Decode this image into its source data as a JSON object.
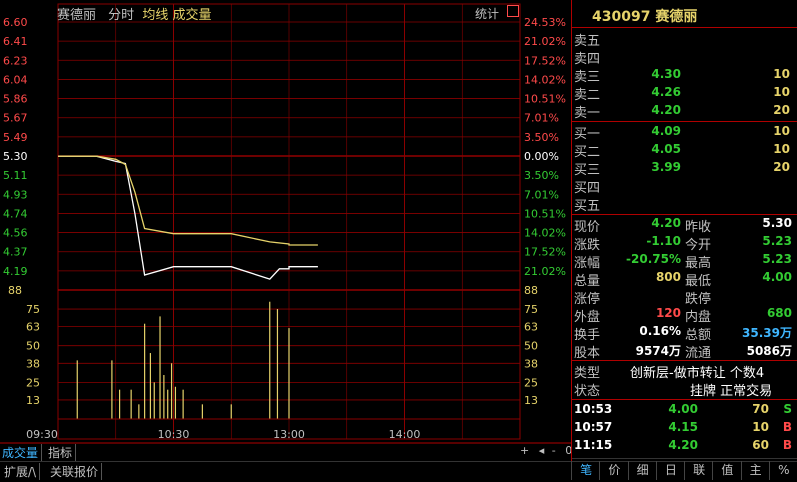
{
  "chart_header": {
    "stock_name": "赛德丽",
    "mode_tab": "分时",
    "legend_avg": "均线",
    "legend_vol": "成交量",
    "stats_btn": "统计"
  },
  "price_axis": {
    "left": [
      "6.60",
      "6.41",
      "6.23",
      "6.04",
      "5.86",
      "5.67",
      "5.49",
      "5.30",
      "5.11",
      "4.93",
      "4.74",
      "4.56",
      "4.37",
      "4.19"
    ],
    "right": [
      "24.53%",
      "21.02%",
      "17.52%",
      "14.02%",
      "10.51%",
      "7.01%",
      "3.50%",
      "0.00%",
      "3.50%",
      "7.01%",
      "10.51%",
      "14.02%",
      "17.52%",
      "21.02%"
    ]
  },
  "volume_axis": [
    "88",
    "75",
    "63",
    "50",
    "38",
    "25",
    "13"
  ],
  "time_axis": [
    "09:30",
    "10:30",
    "13:00",
    "14:00"
  ],
  "chart_data": {
    "type": "line",
    "price_range": [
      4.19,
      6.6
    ],
    "prev_close": 5.3,
    "x_range": [
      "09:30",
      "15:00"
    ],
    "series": [
      {
        "name": "",
        "color": "#ffffff",
        "x": [
          "09:30",
          "09:50",
          "10:00",
          "10:05",
          "10:10",
          "10:15",
          "10:30",
          "11:00",
          "11:20",
          "11:25",
          "11:30",
          "13:00",
          "13:15"
        ],
        "y": [
          5.3,
          5.3,
          5.25,
          5.23,
          4.74,
          4.15,
          4.23,
          4.23,
          4.11,
          4.21,
          4.21,
          4.23,
          4.23
        ]
      },
      {
        "name": "",
        "color": "#e6d36a",
        "x": [
          "09:30",
          "09:50",
          "10:00",
          "10:05",
          "10:10",
          "10:15",
          "10:30",
          "11:00",
          "11:20",
          "11:30",
          "13:00",
          "13:15"
        ],
        "y": [
          5.3,
          5.3,
          5.27,
          5.22,
          4.95,
          4.6,
          4.55,
          4.55,
          4.47,
          4.45,
          4.44,
          4.44
        ]
      }
    ],
    "volume": {
      "ylim": [
        0,
        88
      ],
      "bars": [
        {
          "t": "09:40",
          "v": 40
        },
        {
          "t": "09:58",
          "v": 40
        },
        {
          "t": "10:02",
          "v": 20
        },
        {
          "t": "10:08",
          "v": 20
        },
        {
          "t": "10:12",
          "v": 10
        },
        {
          "t": "10:15",
          "v": 65
        },
        {
          "t": "10:18",
          "v": 45
        },
        {
          "t": "10:20",
          "v": 25
        },
        {
          "t": "10:23",
          "v": 70
        },
        {
          "t": "10:25",
          "v": 30
        },
        {
          "t": "10:27",
          "v": 20
        },
        {
          "t": "10:29",
          "v": 38
        },
        {
          "t": "10:31",
          "v": 22
        },
        {
          "t": "10:35",
          "v": 20
        },
        {
          "t": "10:45",
          "v": 10
        },
        {
          "t": "11:00",
          "v": 10
        },
        {
          "t": "11:20",
          "v": 80
        },
        {
          "t": "11:24",
          "v": 75
        },
        {
          "t": "13:00",
          "v": 62
        }
      ]
    }
  },
  "bottom_tabs": [
    "成交量",
    "指标"
  ],
  "bottom_controls": [
    "+",
    "-",
    "0"
  ],
  "bottom_bar": [
    "扩展/\\",
    "关联报价"
  ],
  "quote": {
    "code_name": "430097 赛德丽",
    "sell": [
      {
        "label": "卖五",
        "price": "",
        "vol": ""
      },
      {
        "label": "卖四",
        "price": "",
        "vol": ""
      },
      {
        "label": "卖三",
        "price": "4.30",
        "vol": "10"
      },
      {
        "label": "卖二",
        "price": "4.26",
        "vol": "10"
      },
      {
        "label": "卖一",
        "price": "4.20",
        "vol": "20"
      }
    ],
    "buy": [
      {
        "label": "买一",
        "price": "4.09",
        "vol": "10"
      },
      {
        "label": "买二",
        "price": "4.05",
        "vol": "10"
      },
      {
        "label": "买三",
        "price": "3.99",
        "vol": "20"
      },
      {
        "label": "买四",
        "price": "",
        "vol": ""
      },
      {
        "label": "买五",
        "price": "",
        "vol": ""
      }
    ],
    "stats": [
      {
        "l1": "现价",
        "v1": "4.20",
        "c1": "green",
        "l2": "昨收",
        "v2": "5.30",
        "c2": "white"
      },
      {
        "l1": "涨跌",
        "v1": "-1.10",
        "c1": "green",
        "l2": "今开",
        "v2": "5.23",
        "c2": "green"
      },
      {
        "l1": "涨幅",
        "v1": "-20.75%",
        "c1": "green",
        "l2": "最高",
        "v2": "5.23",
        "c2": "green"
      },
      {
        "l1": "总量",
        "v1": "800",
        "c1": "yellow",
        "l2": "最低",
        "v2": "4.00",
        "c2": "green"
      },
      {
        "l1": "涨停",
        "v1": "",
        "c1": "white",
        "l2": "跌停",
        "v2": "",
        "c2": "white"
      },
      {
        "l1": "外盘",
        "v1": "120",
        "c1": "red",
        "l2": "内盘",
        "v2": "680",
        "c2": "green"
      },
      {
        "l1": "换手",
        "v1": "0.16%",
        "c1": "white",
        "l2": "总额",
        "v2": "35.39万",
        "c2": "cyan"
      },
      {
        "l1": "股本",
        "v1": "9574万",
        "c1": "white",
        "l2": "流通",
        "v2": "5086万",
        "c2": "white"
      }
    ],
    "type_label": "类型",
    "type_value": "创新层-做市转让 个数4",
    "status_label": "状态",
    "status_value": "挂牌 正常交易",
    "trades": [
      {
        "time": "10:53",
        "price": "4.00",
        "vol": "70",
        "side": "S",
        "side_color": "green"
      },
      {
        "time": "10:57",
        "price": "4.15",
        "vol": "10",
        "side": "B",
        "side_color": "red"
      },
      {
        "time": "11:15",
        "price": "4.20",
        "vol": "60",
        "side": "B",
        "side_color": "red"
      }
    ],
    "bottom_tabs": [
      "笔",
      "价",
      "细",
      "日",
      "联",
      "值",
      "主",
      "%"
    ]
  }
}
